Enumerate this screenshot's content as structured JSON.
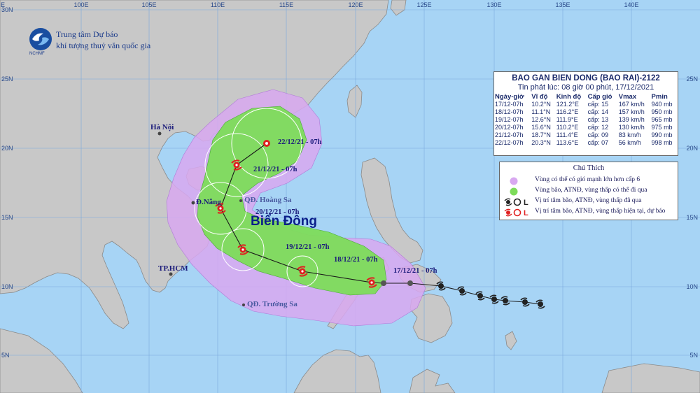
{
  "logo": {
    "line1": "Trung tâm Dự báo",
    "line2": "khí tượng thuỷ văn quốc gia",
    "abbr": "NCHMF"
  },
  "grid": {
    "lon_labels": [
      "E",
      "100E",
      "105E",
      "110E",
      "115E",
      "120E",
      "125E",
      "130E",
      "135E",
      "140E"
    ],
    "lat_labels_left": [
      "30N",
      "25N",
      "20N",
      "15N",
      "10N",
      "5N"
    ],
    "lat_labels_right": [
      "25N",
      "20N",
      "15N",
      "10N",
      "5N"
    ]
  },
  "info_box": {
    "title": "BAO GAN BIEN DONG (BAO RAI)-2122",
    "issued": "Tin phát lúc: 08 giờ 00 phút, 17/12/2021",
    "headers": [
      "Ngày-giờ",
      "Vĩ độ",
      "Kinh độ",
      "Cấp gió",
      "Vmax",
      "Pmin"
    ],
    "rows": [
      [
        "17/12-07h",
        "10.2°N",
        "121.2°E",
        "cấp: 15",
        "167 km/h",
        "940 mb"
      ],
      [
        "18/12-07h",
        "11.1°N",
        "116.2°E",
        "cấp: 14",
        "157 km/h",
        "950 mb"
      ],
      [
        "19/12-07h",
        "12.6°N",
        "111.9°E",
        "cấp: 13",
        "139 km/h",
        "965 mb"
      ],
      [
        "20/12-07h",
        "15.6°N",
        "110.2°E",
        "cấp: 12",
        "130 km/h",
        "975 mb"
      ],
      [
        "21/12-07h",
        "18.7°N",
        "111.4°E",
        "cấp: 09",
        "83 km/h",
        "990 mb"
      ],
      [
        "22/12-07h",
        "20.3°N",
        "113.6°E",
        "cấp: 07",
        "56 km/h",
        "998 mb"
      ]
    ]
  },
  "legend": {
    "title": "Chú Thích",
    "items": [
      "Vùng có thể có gió mạnh lớn hơn cấp 6",
      "Vùng bão, ATNĐ, vùng thấp có thể đi qua",
      "Vị trí tâm bão, ATNĐ, vùng thấp đã qua",
      "Vị trí tâm bão, ATNĐ, vùng thấp hiện tại, dự báo"
    ],
    "colors": {
      "wind_zone": "#d8a8f0",
      "storm_zone": "#7ddc5a",
      "past_marker": "#222222",
      "forecast_marker": "#e02020"
    }
  },
  "map_labels": {
    "sea": "Biển Đông",
    "cities": [
      "Hà Nội",
      "Đ.Nẵng",
      "TP.HCM"
    ],
    "islands": [
      "QĐ. Hoàng Sa",
      "QĐ. Trường Sa"
    ],
    "forecast_dates": [
      "17/12/21 - 07h",
      "18/12/21 - 07h",
      "19/12/21 - 07h",
      "20/12/21 - 07h",
      "21/12/21 - 07h",
      "22/12/21 - 07h"
    ]
  }
}
